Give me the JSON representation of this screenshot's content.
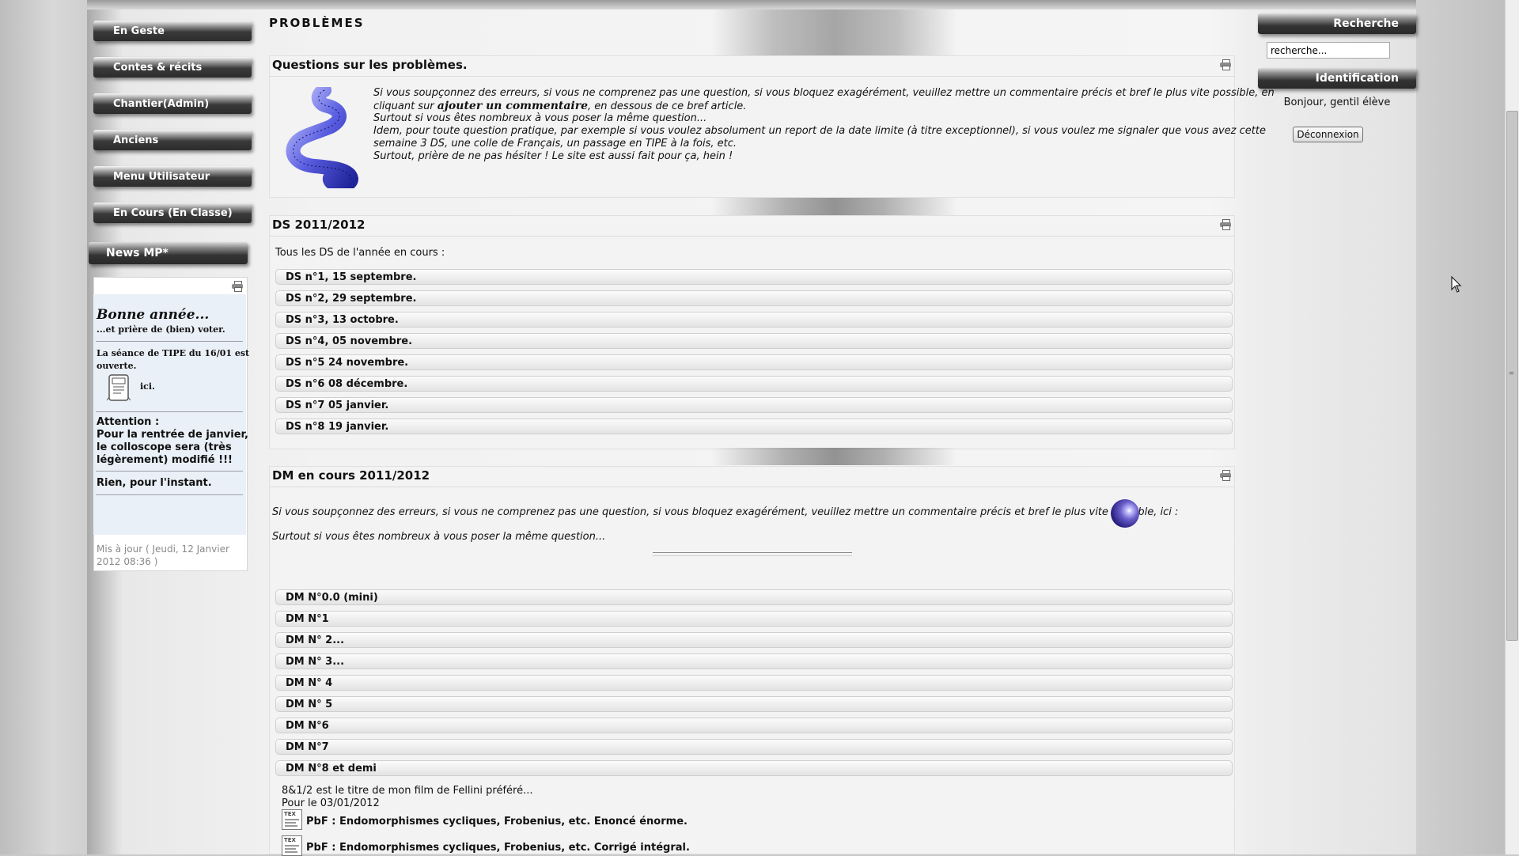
{
  "left_menu": {
    "items": [
      {
        "label": "En Geste"
      },
      {
        "label": "Contes & récits"
      },
      {
        "label": "Chantier(Admin)"
      },
      {
        "label": "Anciens"
      },
      {
        "label": "Menu Utilisateur"
      },
      {
        "label": "En Cours (En Classe)"
      }
    ],
    "news_title": "News MP*",
    "news": {
      "heading": "Bonne année...",
      "subheading": "...et prière de (bien) voter.",
      "tipe_line1": "La séance de TIPE du 16/01 est",
      "tipe_line2": "ouverte.",
      "link_text": "ici.",
      "attention_1": "Attention :",
      "attention_2": "Pour la rentrée de janvier,",
      "attention_3": "le colloscope sera (très",
      "attention_4": "légèrement) modifié !!!",
      "nothing": "Rien, pour l'instant.",
      "updated_1": "Mis à jour ( Jeudi, 12 Janvier",
      "updated_2": "2012 08:36 )"
    }
  },
  "page": {
    "title": "PROBLÈMES"
  },
  "questions": {
    "title": "Questions sur les problèmes.",
    "line1": "Si vous soupçonnez des erreurs, si vous ne comprenez pas une question, si vous bloquez exagérément, veuillez mettre un commentaire précis et bref le plus vite possible, en",
    "line2_pre": "cliquant sur ",
    "line2_link": "ajouter un commentaire",
    "line2_post": ", en dessous de ce bref article.",
    "line3": "Surtout si vous êtes nombreux à vous poser la même question...",
    "line4": "Idem, pour toute question pratique, par exemple si vous voulez absolument un report de la date limite (à titre exceptionnel), si vous voulez me signaler que vous avez cette",
    "line5": "semaine 3 DS, une colle de Français, un passage en TIPE à la fois, etc.",
    "line6": "Surtout, prière de ne pas hésiter ! Le site est aussi fait pour ça, hein !"
  },
  "ds": {
    "title": "DS 2011/2012",
    "intro": "Tous les DS de l'année en cours :",
    "items": [
      "DS n°1, 15 septembre.",
      "DS n°2, 29 septembre.",
      "DS n°3, 13 octobre.",
      "DS n°4, 05 novembre.",
      "DS n°5 24 novembre.",
      "DS n°6 08 décembre.",
      "DS n°7 05 janvier.",
      "DS n°8 19 janvier."
    ]
  },
  "dm": {
    "title": "DM en cours 2011/2012",
    "line1": "Si vous soupçonnez des erreurs, si vous ne comprenez pas une question, si vous bloquez exagérément, veuillez mettre un commentaire précis et bref le plus vite possible, ici :",
    "line2": "Surtout si vous êtes nombreux à vous poser la même question...",
    "items": [
      "DM N°0.0 (mini)",
      "DM N°1",
      "DM N° 2...",
      "DM N° 3...",
      "DM N° 4",
      "DM N° 5",
      "DM N°6",
      "DM N°7",
      "DM N°8 et demi"
    ],
    "dm8_note": "8&1/2 est le titre de mon film de Fellini préféré...",
    "dm8_date": "Pour le 03/01/2012",
    "dm8_file1": "PbF : Endomorphismes cycliques, Frobenius, etc. Enoncé énorme.",
    "dm8_file2": "PbF : Endomorphismes cycliques, Frobenius, etc. Corrigé intégral."
  },
  "right": {
    "search_title": "Recherche",
    "search_value": "recherche...",
    "ident_title": "Identification",
    "greeting": "Bonjour, gentil élève",
    "logout": "Déconnexion"
  },
  "icons": {
    "print": "print-icon",
    "surface": "math-surface-image",
    "ball": "comment-ball-icon",
    "tex": "tex-document-icon",
    "cursor": "mouse-cursor"
  }
}
